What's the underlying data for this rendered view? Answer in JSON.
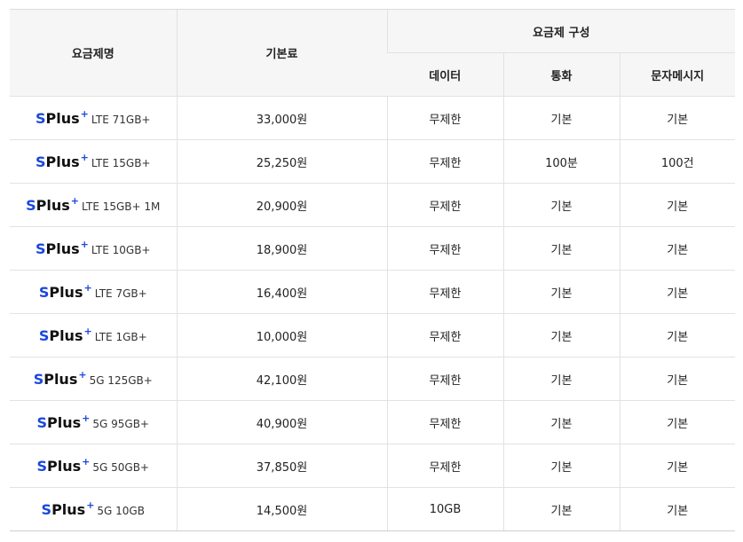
{
  "table": {
    "header": {
      "plan_name": "요금제명",
      "base_fee": "기본료",
      "composition": "요금제 구성",
      "data": "데이터",
      "voice": "통화",
      "sms": "문자메시지"
    },
    "brand": {
      "s": "S",
      "plus": "Plus",
      "mark": "+"
    },
    "rows": [
      {
        "spec": "LTE 71GB+",
        "fee": "33,000원",
        "data": "무제한",
        "voice": "기본",
        "sms": "기본"
      },
      {
        "spec": "LTE 15GB+",
        "fee": "25,250원",
        "data": "무제한",
        "voice": "100분",
        "sms": "100건"
      },
      {
        "spec": "LTE 15GB+ 1M",
        "fee": "20,900원",
        "data": "무제한",
        "voice": "기본",
        "sms": "기본"
      },
      {
        "spec": "LTE 10GB+",
        "fee": "18,900원",
        "data": "무제한",
        "voice": "기본",
        "sms": "기본"
      },
      {
        "spec": "LTE 7GB+",
        "fee": "16,400원",
        "data": "무제한",
        "voice": "기본",
        "sms": "기본"
      },
      {
        "spec": "LTE 1GB+",
        "fee": "10,000원",
        "data": "무제한",
        "voice": "기본",
        "sms": "기본"
      },
      {
        "spec": "5G 125GB+",
        "fee": "42,100원",
        "data": "무제한",
        "voice": "기본",
        "sms": "기본"
      },
      {
        "spec": "5G 95GB+",
        "fee": "40,900원",
        "data": "무제한",
        "voice": "기본",
        "sms": "기본"
      },
      {
        "spec": "5G 50GB+",
        "fee": "37,850원",
        "data": "무제한",
        "voice": "기본",
        "sms": "기본"
      },
      {
        "spec": "5G 10GB",
        "fee": "14,500원",
        "data": "10GB",
        "voice": "기본",
        "sms": "기본"
      }
    ],
    "colors": {
      "brand_blue": "#1a48dd",
      "header_bg": "#f6f6f6",
      "border": "#e2e2e2"
    }
  }
}
